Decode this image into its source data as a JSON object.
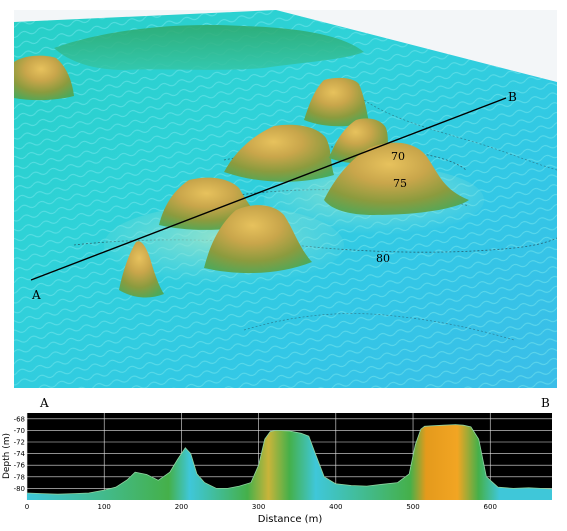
{
  "map": {
    "transect_start_label": "A",
    "transect_end_label": "B",
    "contours": [
      "70",
      "75",
      "80"
    ]
  },
  "profile": {
    "left_label": "A",
    "right_label": "B",
    "colors": {
      "background": "#000000",
      "grid": "#e6e6e6",
      "deep": "#3fc7d9",
      "mid": "#45b04a",
      "peak": "#e49a1c"
    }
  },
  "chart_data": {
    "type": "area",
    "title": "",
    "xlabel": "Distance (m)",
    "ylabel": "Depth (m)",
    "xlim": [
      0,
      680
    ],
    "ylim": [
      -82,
      -67
    ],
    "x_ticks": [
      "0",
      "100",
      "200",
      "300",
      "400",
      "500",
      "600"
    ],
    "y_ticks": [
      "-68",
      "-70",
      "-72",
      "-74",
      "-76",
      "-78",
      "-80"
    ],
    "grid": true,
    "series": [
      {
        "x": [
          0,
          20,
          40,
          60,
          80,
          100,
          115,
          130,
          140,
          155,
          170,
          185,
          195,
          205,
          212,
          220,
          230,
          245,
          260,
          275,
          290,
          300,
          308,
          315,
          322,
          340,
          355,
          365,
          372,
          385,
          400,
          420,
          440,
          460,
          480,
          495,
          503,
          510,
          515,
          525,
          540,
          555,
          565,
          575,
          585,
          595,
          610,
          630,
          650,
          665,
          680
        ],
        "y": [
          -80.8,
          -80.9,
          -81.0,
          -80.9,
          -80.8,
          -80.3,
          -79.8,
          -78.5,
          -77.2,
          -77.6,
          -78.6,
          -77.2,
          -75.0,
          -73.0,
          -74.0,
          -77.5,
          -79.0,
          -80.0,
          -80.0,
          -79.6,
          -79.0,
          -76.0,
          -71.5,
          -70.2,
          -70.0,
          -70.1,
          -70.5,
          -71.0,
          -73.5,
          -78.0,
          -79.2,
          -79.5,
          -79.6,
          -79.3,
          -79.0,
          -77.5,
          -72.5,
          -69.8,
          -69.3,
          -69.2,
          -69.1,
          -69.0,
          -69.1,
          -69.4,
          -71.5,
          -78.0,
          -79.8,
          -80.0,
          -79.9,
          -80.0,
          -80.1
        ]
      }
    ]
  }
}
